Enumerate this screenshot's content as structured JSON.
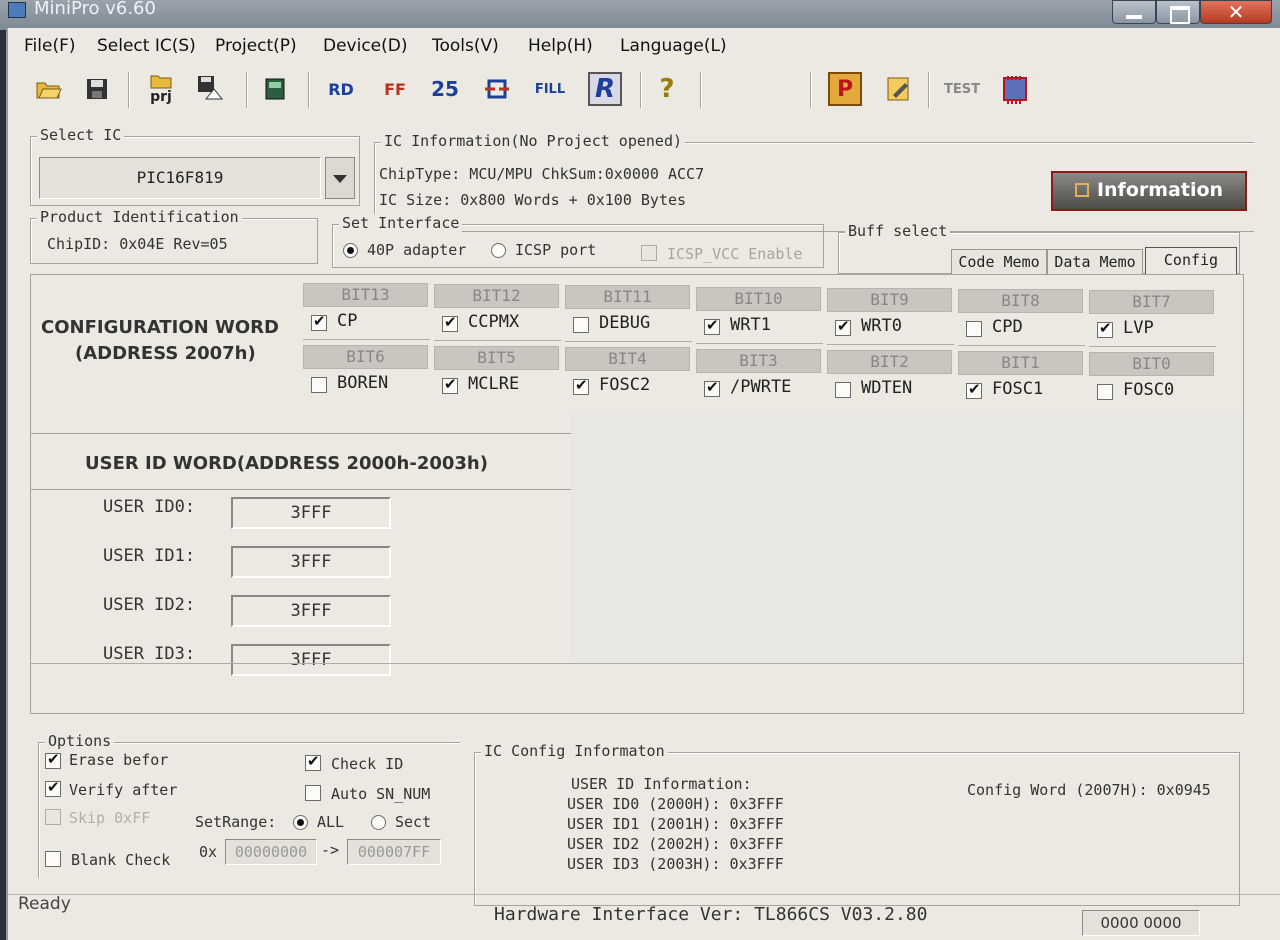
{
  "window": {
    "title": "MiniPro v6.60",
    "close_glyph": "✕"
  },
  "menu": [
    "File(F)",
    "Select IC(S)",
    "Project(P)",
    "Device(D)",
    "Tools(V)",
    "Help(H)",
    "Language(L)"
  ],
  "toolbar": {
    "prj_label": "prj",
    "fill_label": "FILL",
    "r_label": "R",
    "test_label": "TEST",
    "p_label": "P",
    "rd_label": "RD",
    "ff_label": "FF",
    "n25_label": "25",
    "help_label": "?"
  },
  "select_ic": {
    "legend": "Select IC",
    "value": "PIC16F819"
  },
  "ic_info": {
    "legend": "IC Information(No Project opened)",
    "chiptype": "ChipType: MCU/MPU  ChkSum:0x0000 ACC7",
    "size": "IC Size:  0x800 Words + 0x100 Bytes",
    "info_button": "Information"
  },
  "product_id": {
    "legend": "Product Identification",
    "value": "ChipID: 0x04E Rev=05"
  },
  "interface": {
    "legend": "Set Interface",
    "adapter": "40P adapter",
    "icsp": "ICSP port",
    "icsp_vcc": "ICSP_VCC Enable"
  },
  "buff": {
    "legend": "Buff select",
    "tabs": [
      "Code Memo",
      "Data Memo",
      "Config"
    ]
  },
  "config_word": {
    "title_line1": "CONFIGURATION WORD",
    "title_line2": "(ADDRESS 2007h)",
    "row1": [
      {
        "bit": "BIT13",
        "name": "CP",
        "checked": true
      },
      {
        "bit": "BIT12",
        "name": "CCPMX",
        "checked": true
      },
      {
        "bit": "BIT11",
        "name": "DEBUG",
        "checked": false
      },
      {
        "bit": "BIT10",
        "name": "WRT1",
        "checked": true
      },
      {
        "bit": "BIT9",
        "name": "WRT0",
        "checked": true
      },
      {
        "bit": "BIT8",
        "name": "CPD",
        "checked": false
      },
      {
        "bit": "BIT7",
        "name": "LVP",
        "checked": true
      }
    ],
    "row2": [
      {
        "bit": "BIT6",
        "name": "BOREN",
        "checked": false
      },
      {
        "bit": "BIT5",
        "name": "MCLRE",
        "checked": true
      },
      {
        "bit": "BIT4",
        "name": "FOSC2",
        "checked": true
      },
      {
        "bit": "BIT3",
        "name": "/PWRTE",
        "checked": true
      },
      {
        "bit": "BIT2",
        "name": "WDTEN",
        "checked": false
      },
      {
        "bit": "BIT1",
        "name": "FOSC1",
        "checked": true
      },
      {
        "bit": "BIT0",
        "name": "FOSC0",
        "checked": false
      }
    ]
  },
  "user_id": {
    "title": "USER ID WORD(ADDRESS 2000h-2003h)",
    "items": [
      {
        "label": "USER ID0:",
        "value": "3FFF"
      },
      {
        "label": "USER ID1:",
        "value": "3FFF"
      },
      {
        "label": "USER ID2:",
        "value": "3FFF"
      },
      {
        "label": "USER ID3:",
        "value": "3FFF"
      }
    ]
  },
  "options": {
    "legend": "Options",
    "erase": "Erase befor",
    "verify": "Verify after",
    "skip": "Skip 0xFF",
    "blank": "Blank Check",
    "check_id": "Check ID",
    "auto_sn": "Auto SN_NUM",
    "setrange": "SetRange:",
    "all": "ALL",
    "sect": "Sect",
    "hex_prefix": "0x",
    "range_from": "00000000",
    "arrow": "->",
    "range_to": "000007FF"
  },
  "ic_config": {
    "legend": "IC Config Informaton",
    "user_id_header": "USER ID Information:",
    "lines": [
      "USER ID0 (2000H): 0x3FFF",
      "USER ID1 (2001H): 0x3FFF",
      "USER ID2 (2002H): 0x3FFF",
      "USER ID3 (2003H): 0x3FFF"
    ],
    "config_word": "Config Word (2007H): 0x0945"
  },
  "status": {
    "ready": "Ready",
    "hardware": "Hardware Interface Ver: TL866CS V03.2.80",
    "counter": "0000 0000"
  }
}
